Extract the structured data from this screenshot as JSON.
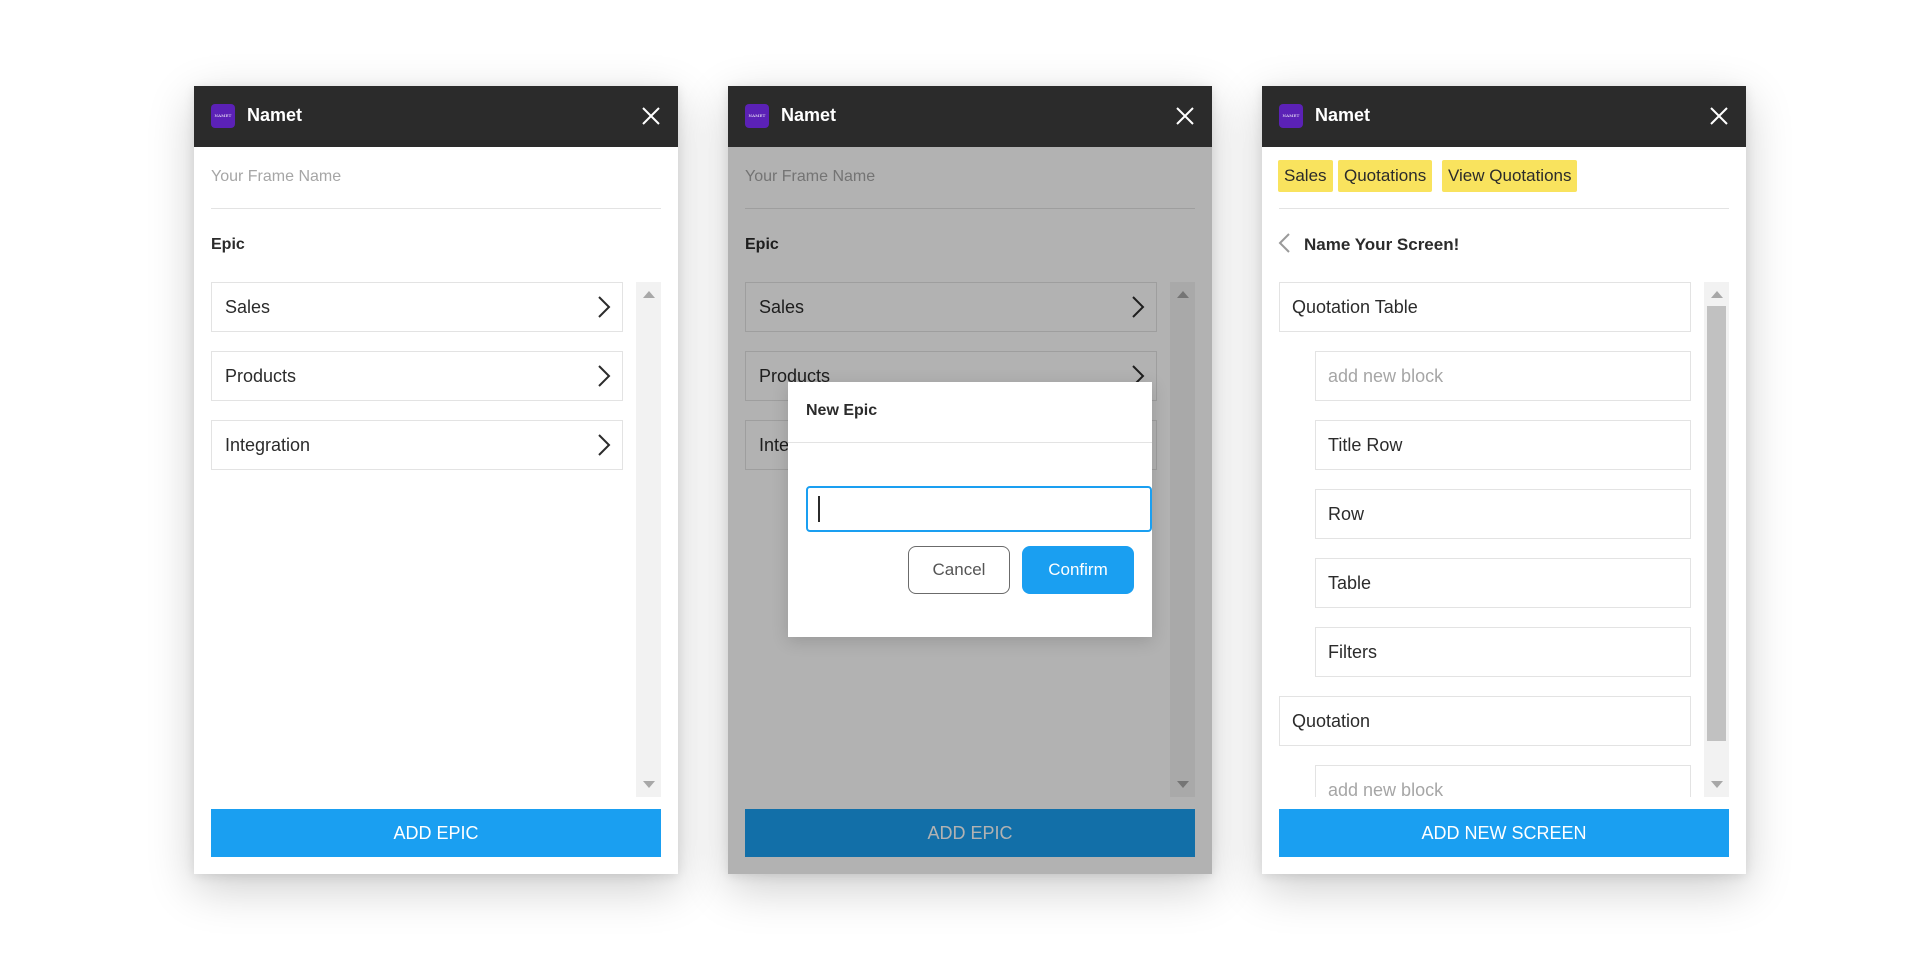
{
  "panels": {
    "p1": {
      "app_title": "Namet",
      "logo_text": "NAMET",
      "frame_placeholder": "Your Frame Name",
      "section_label": "Epic",
      "epics": [
        {
          "label": "Sales"
        },
        {
          "label": "Products"
        },
        {
          "label": "Integration"
        }
      ],
      "add_button": "ADD EPIC"
    },
    "p2": {
      "app_title": "Namet",
      "logo_text": "NAMET",
      "frame_placeholder": "Your Frame Name",
      "section_label": "Epic",
      "epics": [
        {
          "label": "Sales"
        },
        {
          "label": "Products"
        },
        {
          "label": "Integration"
        }
      ],
      "add_button": "ADD EPIC",
      "modal": {
        "title": "New Epic",
        "input_value": "",
        "cancel_label": "Cancel",
        "confirm_label": "Confirm"
      }
    },
    "p3": {
      "app_title": "Namet",
      "logo_text": "NAMET",
      "breadcrumbs": [
        "Sales",
        "Quotations",
        "View Quotations"
      ],
      "screen_title": "Name Your Screen!",
      "groups": [
        {
          "label": "Quotation Table",
          "blocks": [
            "add new block",
            "Title Row",
            "Row",
            "Table",
            "Filters"
          ]
        },
        {
          "label": "Quotation",
          "blocks": [
            "add new block"
          ]
        }
      ],
      "add_button": "ADD NEW SCREEN"
    }
  },
  "colors": {
    "header": "#2b2b2b",
    "accent": "#1a9ff1",
    "logo": "#5b21b6",
    "breadcrumb_highlight": "#f9e35e"
  },
  "icons": [
    "close-icon",
    "chevron-right-icon",
    "chevron-left-icon",
    "scroll-up-arrow",
    "scroll-down-arrow"
  ]
}
